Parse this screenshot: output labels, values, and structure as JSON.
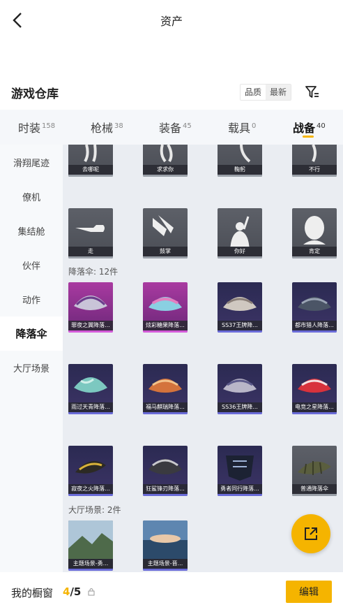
{
  "header": {
    "title": "资产"
  },
  "warehouse": {
    "title": "游戏仓库",
    "sort_options": [
      "品质",
      "最新"
    ],
    "filter_icon": "filter-icon"
  },
  "tabs": [
    {
      "label": "时装",
      "count": "158"
    },
    {
      "label": "枪械",
      "count": "38"
    },
    {
      "label": "装备",
      "count": "45"
    },
    {
      "label": "载具",
      "count": "0"
    },
    {
      "label": "战备",
      "count": "40",
      "active": true
    }
  ],
  "sidebar": [
    {
      "label": "滑翔尾迹"
    },
    {
      "label": "僚机"
    },
    {
      "label": "集结舱"
    },
    {
      "label": "伙伴"
    },
    {
      "label": "动作"
    },
    {
      "label": "降落伞",
      "active": true
    },
    {
      "label": "大厅场景"
    }
  ],
  "actions_partial": [
    {
      "name": "去哪呢"
    },
    {
      "name": "求求你"
    },
    {
      "name": "鞠躬"
    },
    {
      "name": "不行"
    }
  ],
  "actions": [
    {
      "name": "走"
    },
    {
      "name": "鼓掌"
    },
    {
      "name": "你好"
    },
    {
      "name": "肯定"
    }
  ],
  "parachute_section": "降落伞: 12件",
  "parachutes": [
    {
      "name": "罪夜之翼降落..."
    },
    {
      "name": "炫彩糖果降落..."
    },
    {
      "name": "SS37王牌降..."
    },
    {
      "name": "都市猎人降落..."
    },
    {
      "name": "雨过天青降落..."
    },
    {
      "name": "福马麒瑞降落..."
    },
    {
      "name": "SS36王牌降..."
    },
    {
      "name": "电竞之星降落..."
    },
    {
      "name": "寂夜之火降落..."
    },
    {
      "name": "狂鲨锋刃降落..."
    },
    {
      "name": "勇者同行降落..."
    },
    {
      "name": "普通降落伞"
    }
  ],
  "scene_section": "大厅场景: 2件",
  "scenes": [
    {
      "name": "主题场景-勇..."
    },
    {
      "name": "主题场景-晋..."
    }
  ],
  "bottom": {
    "label": "我的橱窗",
    "current": "4",
    "separator": "/",
    "total": "5",
    "edit_label": "编辑"
  },
  "colors": {
    "accent": "#f5b400",
    "rarity_bar": "#6a6bd8"
  }
}
